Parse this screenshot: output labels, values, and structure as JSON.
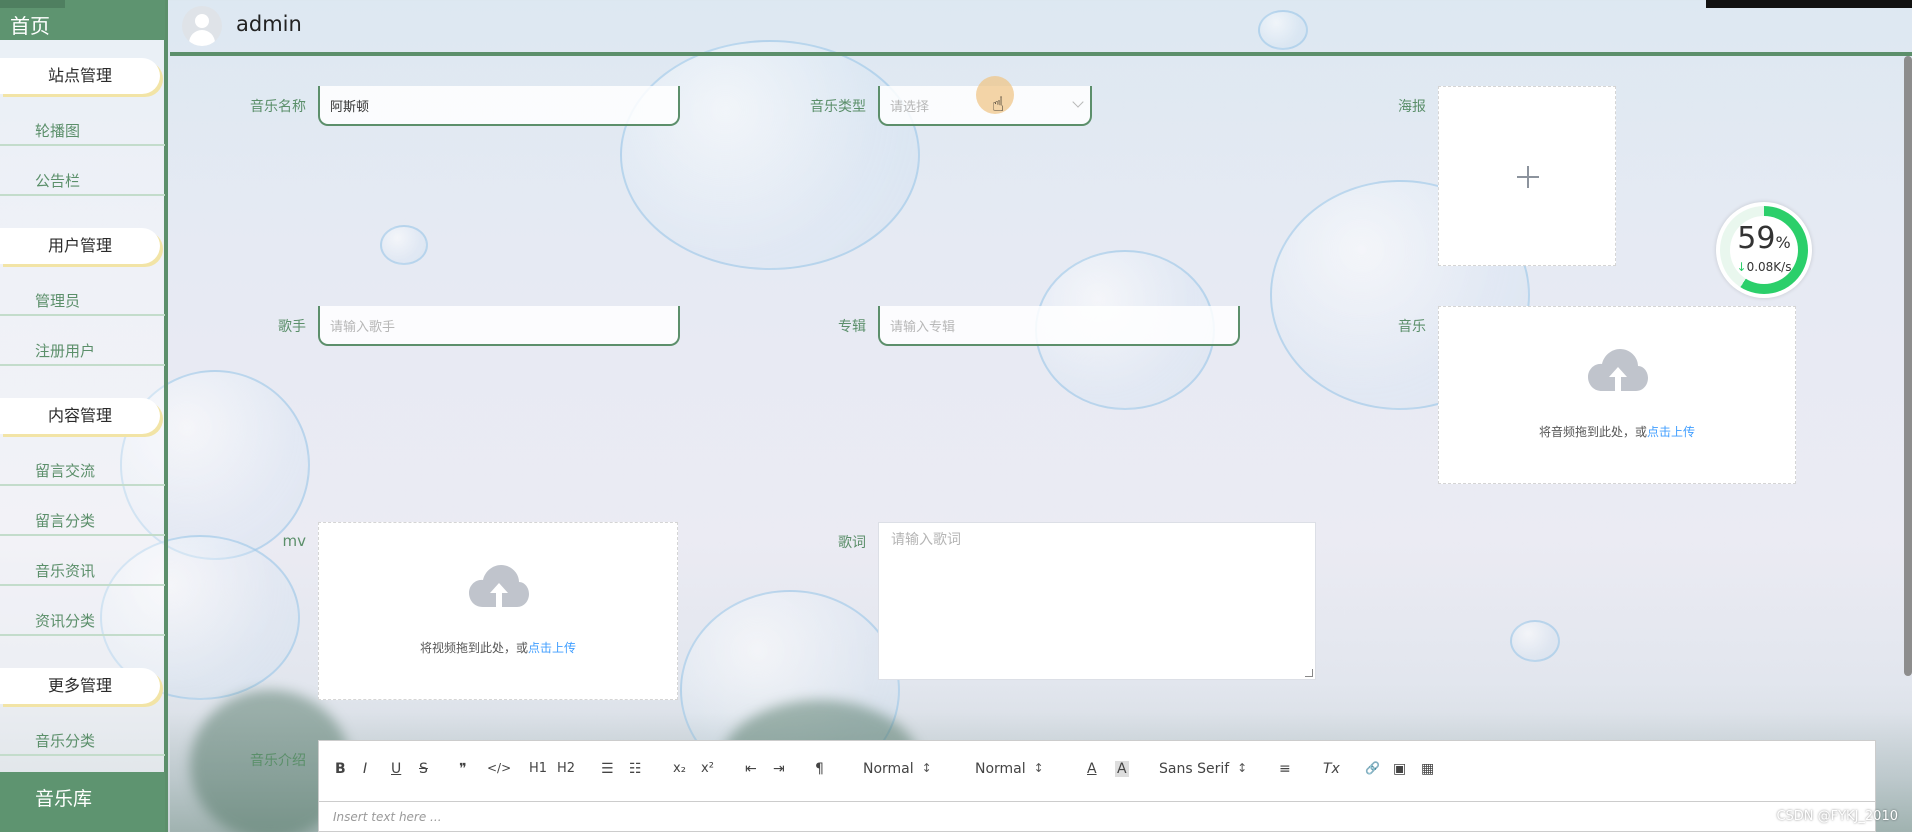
{
  "sidebar": {
    "home": "首页",
    "groups": [
      {
        "title": "站点管理",
        "items": [
          "轮播图",
          "公告栏"
        ]
      },
      {
        "title": "用户管理",
        "items": [
          "管理员",
          "注册用户"
        ]
      },
      {
        "title": "内容管理",
        "items": [
          "留言交流",
          "留言分类",
          "音乐资讯",
          "资讯分类"
        ]
      },
      {
        "title": "更多管理",
        "items": [
          "音乐分类"
        ]
      }
    ],
    "footer": "音乐库"
  },
  "header": {
    "username": "admin"
  },
  "form": {
    "music_name": {
      "label": "音乐名称",
      "value": "阿斯顿"
    },
    "music_type": {
      "label": "音乐类型",
      "placeholder": "请选择"
    },
    "poster": {
      "label": "海报"
    },
    "singer": {
      "label": "歌手",
      "placeholder": "请输入歌手"
    },
    "album": {
      "label": "专辑",
      "placeholder": "请输入专辑"
    },
    "music": {
      "label": "音乐",
      "hint": "将音频拖到此处，或",
      "link": "点击上传"
    },
    "mv": {
      "label": "mv",
      "hint": "将视频拖到此处，或",
      "link": "点击上传"
    },
    "lyrics": {
      "label": "歌词",
      "placeholder": "请输入歌词"
    },
    "intro": {
      "label": "音乐介绍"
    }
  },
  "editor": {
    "toolbar": {
      "bold": "B",
      "italic": "I",
      "underline": "U",
      "strike": "S",
      "quote": "❞",
      "code": "</>",
      "h1": "H1",
      "h2": "H2",
      "ol": "☰",
      "ul": "☷",
      "sub": "x₂",
      "sup": "x²",
      "outdent": "⇤",
      "indent": "⇥",
      "direction": "¶",
      "size": "Normal",
      "header": "Normal",
      "color": "A",
      "background": "A",
      "font": "Sans Serif",
      "align": "≡",
      "clean": "Tx",
      "link": "🔗",
      "image": "▣",
      "video": "▦"
    },
    "placeholder": "Insert text here ..."
  },
  "speed_widget": {
    "percent": "59",
    "percent_unit": "%",
    "rate_arrow": "↓",
    "rate": "0.08K/s"
  },
  "watermark": "CSDN @FYKJ_2010",
  "colors": {
    "accent": "#5c8f6b",
    "link": "#409eff"
  }
}
